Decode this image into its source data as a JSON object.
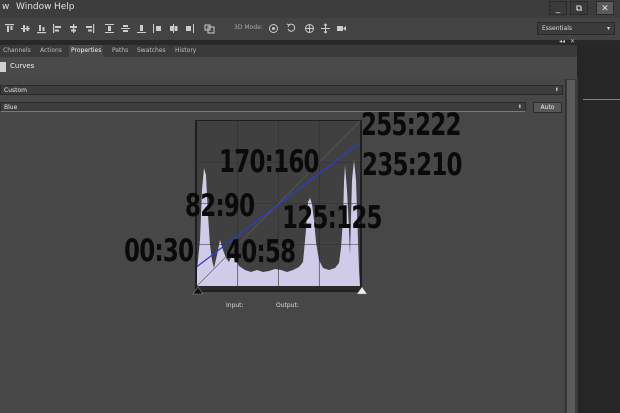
{
  "menubar": {
    "items": [
      "w",
      "Window",
      "Help"
    ],
    "window_buttons": [
      "_",
      "⧉",
      "✕"
    ]
  },
  "toolbar": {
    "mode_label": "3D Mode:",
    "workspace": "Essentials"
  },
  "panel_tabs": [
    {
      "label": "Channels",
      "active": false
    },
    {
      "label": "Actions",
      "active": false
    },
    {
      "label": "Properties",
      "active": true
    },
    {
      "label": "Paths",
      "active": false
    },
    {
      "label": "Swatches",
      "active": false
    },
    {
      "label": "History",
      "active": false
    }
  ],
  "strip_controls": {
    "collapse": "◂◂",
    "close": "✕"
  },
  "properties": {
    "title": "Curves",
    "preset": "Custom",
    "channel": "Blue",
    "auto_label": "Auto"
  },
  "curve": {
    "line_color": "#2c3bcf",
    "points": [
      {
        "input": 0,
        "output": 30
      },
      {
        "input": 255,
        "output": 222
      }
    ]
  },
  "io_labels": {
    "input": "Input:",
    "output": "Output:"
  },
  "annotations": [
    "255:222",
    "170:160",
    "235:210",
    "82:90",
    "125:125",
    "00:30",
    "40:58"
  ],
  "colors": {
    "histogram_fill": "#cfcbe9",
    "teal_accent": "#2fa6a0"
  }
}
